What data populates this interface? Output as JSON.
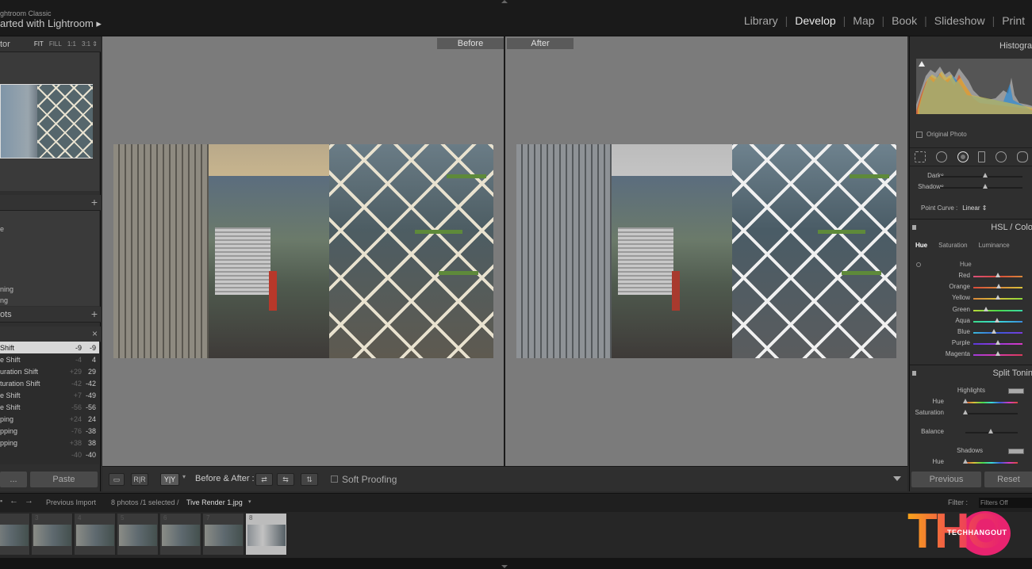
{
  "app": {
    "brand_small": "ghtroom Classic",
    "brand_title": "arted with Lightroom ▸"
  },
  "modules": [
    {
      "label": "Library",
      "active": false
    },
    {
      "label": "Develop",
      "active": true
    },
    {
      "label": "Map",
      "active": false
    },
    {
      "label": "Book",
      "active": false
    },
    {
      "label": "Slideshow",
      "active": false
    },
    {
      "label": "Print",
      "active": false
    }
  ],
  "left": {
    "navigator": {
      "title": "tor",
      "zoom": [
        "FIT",
        "FILL",
        "1:1",
        "3:1 ⇕"
      ]
    },
    "presets": {
      "plus": "+",
      "items": [
        "e",
        "ning",
        "ng"
      ]
    },
    "snapshots": {
      "title": "ots",
      "plus": "+"
    },
    "history": {
      "close": "×",
      "rows": [
        {
          "name": "Shift",
          "a": "-9",
          "b": "-9",
          "selected": true
        },
        {
          "name": "e Shift",
          "a": "-4",
          "b": "4",
          "selected": false
        },
        {
          "name": "uration Shift",
          "a": "+29",
          "b": "29",
          "selected": false
        },
        {
          "name": "turation Shift",
          "a": "-42",
          "b": "-42",
          "selected": false
        },
        {
          "name": "e Shift",
          "a": "+7",
          "b": "-49",
          "selected": false
        },
        {
          "name": "e Shift",
          "a": "-56",
          "b": "-56",
          "selected": false
        },
        {
          "name": "ping",
          "a": "+24",
          "b": "24",
          "selected": false
        },
        {
          "name": "pping",
          "a": "-76",
          "b": "-38",
          "selected": false
        },
        {
          "name": "pping",
          "a": "+38",
          "b": "38",
          "selected": false
        },
        {
          "name": "",
          "a": "-40",
          "b": "-40",
          "selected": false
        }
      ]
    },
    "copy_label": "...",
    "paste_label": "Paste"
  },
  "center": {
    "before_label": "Before",
    "after_label": "After"
  },
  "toolbar": {
    "before_after_label": "Before & After :",
    "soft_proofing": "Soft Proofing",
    "yy_label": "Y|Y",
    "loupe_label": "▭",
    "survey_label": "R|R"
  },
  "right": {
    "histogram_title": "Histogra",
    "original_photo": "Original Photo",
    "tone_sliders": [
      {
        "label": "Darks",
        "pos": 0.55
      },
      {
        "label": "Shadows",
        "pos": 0.55
      }
    ],
    "point_curve_label": "Point Curve :",
    "point_curve_value": "Linear ⇕",
    "hsl_title": "HSL / Colo",
    "hsl_tabs": [
      {
        "label": "Hue",
        "active": true
      },
      {
        "label": "Saturation",
        "active": false
      },
      {
        "label": "Luminance",
        "active": false
      }
    ],
    "hue_title": "Hue",
    "hue_rows": [
      {
        "label": "Red",
        "pos": 0.5,
        "gradient": "linear-gradient(90deg,#d9507a,#d94a3a,#d9873a)"
      },
      {
        "label": "Orange",
        "pos": 0.52,
        "gradient": "linear-gradient(90deg,#d94a3a,#d9873a,#d9c33a)"
      },
      {
        "label": "Yellow",
        "pos": 0.5,
        "gradient": "linear-gradient(90deg,#d9873a,#d9c33a,#8ad93a)"
      },
      {
        "label": "Green",
        "pos": 0.25,
        "gradient": "linear-gradient(90deg,#b8d93a,#4ad94a,#3ad9a8)"
      },
      {
        "label": "Aqua",
        "pos": 0.48,
        "gradient": "linear-gradient(90deg,#3ad98a,#3ad9d9,#3a8ad9)"
      },
      {
        "label": "Blue",
        "pos": 0.42,
        "gradient": "linear-gradient(90deg,#3ab8d9,#3a5ad9,#7a3ad9)"
      },
      {
        "label": "Purple",
        "pos": 0.5,
        "gradient": "linear-gradient(90deg,#5a3ad9,#9a3ad9,#d93ac3)"
      },
      {
        "label": "Magenta",
        "pos": 0.5,
        "gradient": "linear-gradient(90deg,#a03ad9,#d93aa8,#d93a5a)"
      }
    ],
    "split_title": "Split Tonin",
    "split_highlights": "Highlights",
    "split_hue": "Hue",
    "split_saturation": "Saturation",
    "split_balance": "Balance",
    "split_shadows": "Shadows",
    "split_hue2": "Hue",
    "previous_label": "Previous",
    "reset_label": "Reset"
  },
  "filmbar": {
    "source": "Previous Import",
    "count": "8 photos /1 selected /",
    "filename": "Tive Render 1.jpg",
    "filter_label": "Filter :",
    "filter_value": "Filters Off"
  },
  "filmstrip": [
    {
      "num": "",
      "selected": false
    },
    {
      "num": "3",
      "selected": false
    },
    {
      "num": "4",
      "selected": false
    },
    {
      "num": "5",
      "selected": false
    },
    {
      "num": "6",
      "selected": false
    },
    {
      "num": "7",
      "selected": false
    },
    {
      "num": "8",
      "selected": true
    }
  ],
  "watermark": {
    "letters": "THO",
    "text": "TECHHANGOUT"
  }
}
